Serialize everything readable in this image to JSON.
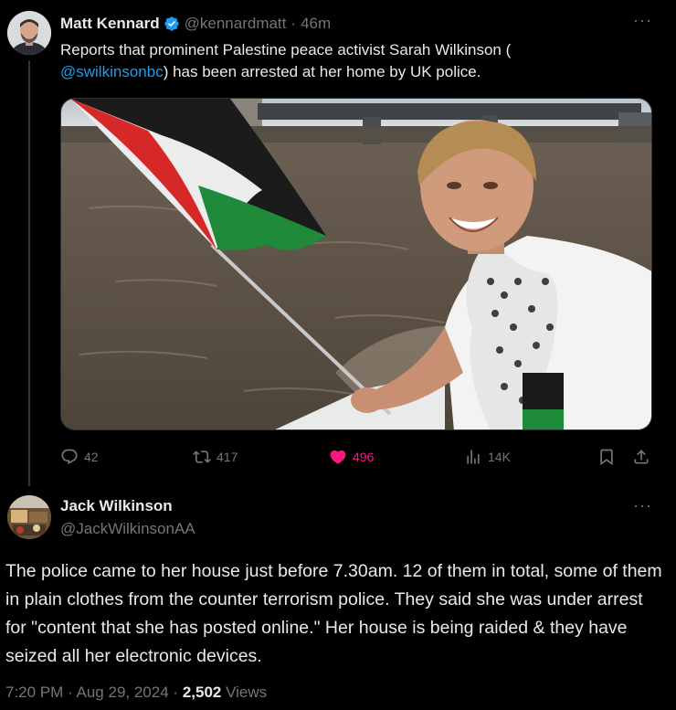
{
  "tweet1": {
    "author_name": "Matt Kennard",
    "handle": "@kennardmatt",
    "separator": "·",
    "time": "46m",
    "text_before": "Reports that prominent Palestine peace activist Sarah Wilkinson (",
    "mention": "@swilkinsonbc",
    "text_after": ") has been arrested at her home by UK police.",
    "more_label": "···",
    "stats": {
      "replies": "42",
      "reposts": "417",
      "likes": "496",
      "views": "14K"
    }
  },
  "tweet2": {
    "author_name": "Jack Wilkinson",
    "handle": "@JackWilkinsonAA",
    "more_label": "···",
    "text": "The police came to her house just before 7.30am. 12 of them in total, some of them in plain clothes from the counter terrorism police. They said she was under arrest for \"content that she has posted online.\" Her house is being raided & they have seized all her electronic devices.",
    "time": "7:20 PM",
    "date": "Aug 29, 2024",
    "separator": "·",
    "views_count": "2,502",
    "views_label": "Views"
  },
  "colors": {
    "accent": "#1d9bf0",
    "like": "#f91880",
    "muted": "#71767b",
    "text": "#e7e9ea",
    "background": "#000000"
  },
  "icons": {
    "verified": "verified-badge-icon",
    "reply": "reply-icon",
    "repost": "repost-icon",
    "like": "heart-icon",
    "views": "views-bar-chart-icon",
    "bookmark": "bookmark-icon",
    "share": "share-icon",
    "more": "more-options-icon"
  }
}
